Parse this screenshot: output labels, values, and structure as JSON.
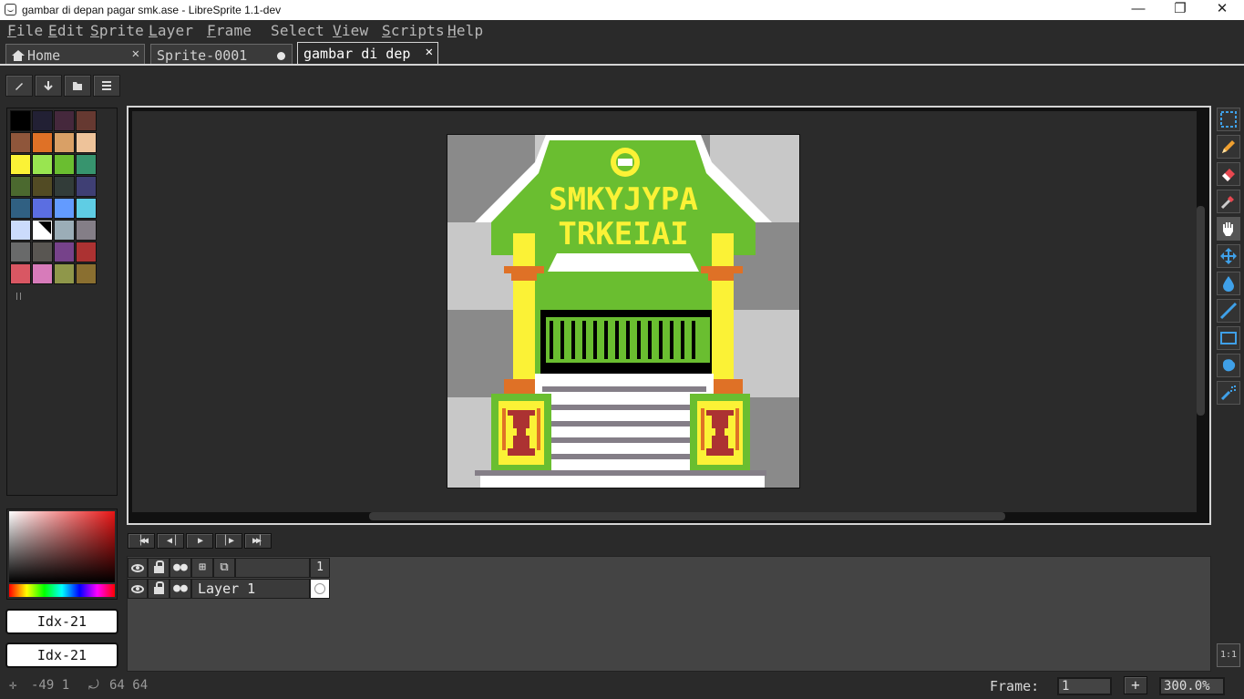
{
  "window": {
    "title": "gambar di depan pagar smk.ase - LibreSprite 1.1-dev",
    "minimize": "—",
    "maximize": "❐",
    "close": "✕"
  },
  "menu": [
    {
      "label": "File",
      "u": "F",
      "rest": "ile"
    },
    {
      "label": "Edit",
      "u": "E",
      "rest": "dit"
    },
    {
      "label": "Sprite",
      "u": "S",
      "rest": "prite"
    },
    {
      "label": "Layer",
      "u": "L",
      "rest": "ayer"
    },
    {
      "label": "Frame",
      "u": "F",
      "rest": "rame"
    },
    {
      "label": "Select",
      "u": "",
      "rest": "Select"
    },
    {
      "label": "View",
      "u": "V",
      "rest": "iew"
    },
    {
      "label": "Scripts",
      "u": "S",
      "rest": "cripts"
    },
    {
      "label": "Help",
      "u": "H",
      "rest": "elp"
    }
  ],
  "tabs": [
    {
      "label": "Home",
      "icon": "home-icon",
      "close": "✕"
    },
    {
      "label": "Sprite-0001",
      "modified": true
    },
    {
      "label": "gambar di dep",
      "close": "✕",
      "active": true
    }
  ],
  "palette_toolbar": [
    "edit-palette-icon",
    "download-palette-icon",
    "save-palette-icon",
    "options-icon"
  ],
  "palette_colors": [
    "#000000",
    "#222034",
    "#45283c",
    "#663931",
    "#8f563b",
    "#df7126",
    "#d9a066",
    "#eec39a",
    "#fbf236",
    "#99e550",
    "#6abe30",
    "#37946e",
    "#4b692f",
    "#524b24",
    "#323c39",
    "#3f3f74",
    "#306082",
    "#5b6ee1",
    "#639bff",
    "#5fcde4",
    "#cbdbfc",
    "#ffffff",
    "#9badb7",
    "#847e87",
    "#696a6a",
    "#595652",
    "#76428a",
    "#ac3232",
    "#d95763",
    "#d77bba",
    "#8f974a",
    "#8a6f30"
  ],
  "selected_palette_index": 21,
  "foreground_label": "Idx-21",
  "background_label": "Idx-21",
  "tools": [
    "marquee-icon",
    "pencil-icon",
    "eraser-icon",
    "eyedropper-icon",
    "hand-icon",
    "move-icon",
    "paint-bucket-icon",
    "line-icon",
    "rectangle-icon",
    "contour-icon",
    "spray-icon"
  ],
  "sprite_text": {
    "line1": "SMKYJYPA",
    "line2": "TRKEIAI"
  },
  "animation_controls": [
    "first-frame-icon",
    "previous-frame-icon",
    "play-icon",
    "next-frame-icon",
    "last-frame-icon"
  ],
  "timeline": {
    "frame_number": "1",
    "layer_name": "Layer 1"
  },
  "status": {
    "cursor_pos": "-49 1",
    "sprite_size": "64 64",
    "frame_label": "Frame:",
    "frame_value": "1",
    "add_frame": "+",
    "zoom": "300.0%",
    "one_to_one": "1:1"
  }
}
